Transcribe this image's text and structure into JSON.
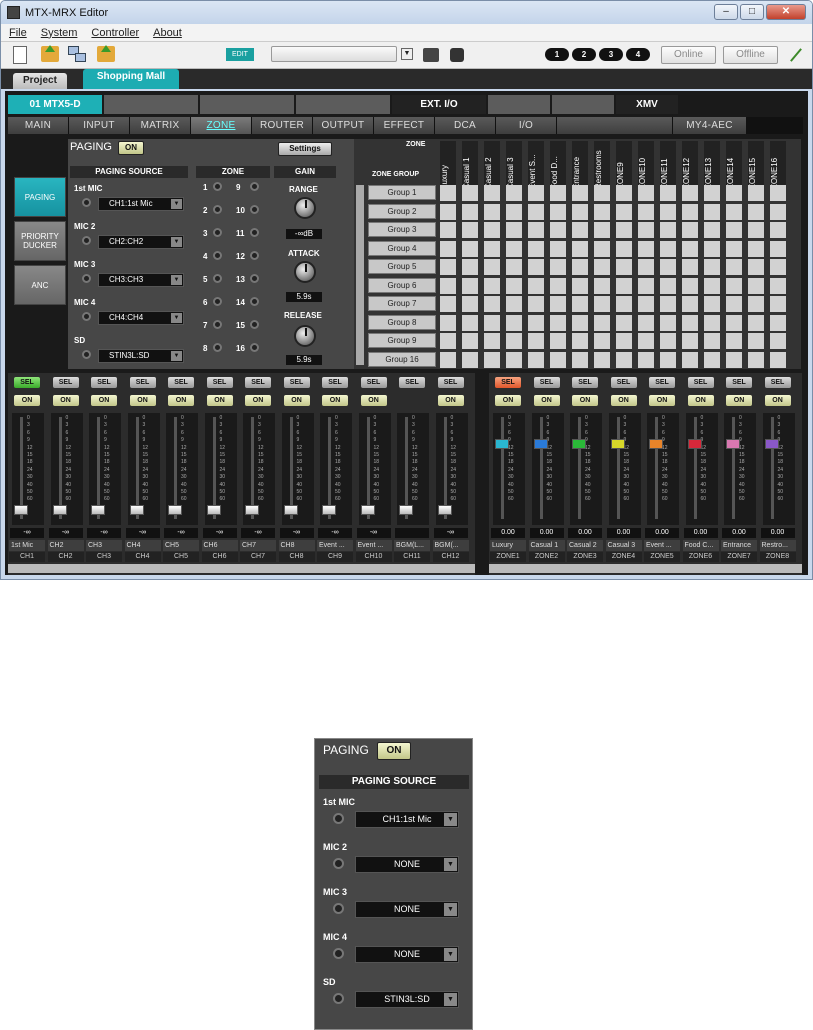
{
  "window": {
    "title": "MTX-MRX Editor"
  },
  "menu": [
    "File",
    "System",
    "Controller",
    "About"
  ],
  "toolbar": {
    "edit_badge": "EDIT",
    "devices": [
      "1",
      "2",
      "3",
      "4"
    ],
    "online": "Online",
    "offline": "Offline"
  },
  "project_tabs": {
    "project": "Project",
    "current": "Shopping Mall"
  },
  "device_tabs": [
    "01 MTX5-D",
    "",
    "",
    "",
    "EXT. I/O",
    "",
    "",
    "XMV"
  ],
  "function_tabs": [
    "MAIN",
    "INPUT",
    "MATRIX",
    "ZONE",
    "ROUTER",
    "OUTPUT",
    "EFFECT",
    "DCA",
    "I/O",
    "",
    "MY4-AEC"
  ],
  "left_nav": [
    "PAGING",
    "PRIORITY DUCKER",
    "ANC"
  ],
  "paging": {
    "title": "PAGING",
    "on": "ON",
    "settings": "Settings",
    "source_title": "PAGING SOURCE",
    "zone_title": "ZONE",
    "gain_title": "GAIN",
    "sources": [
      {
        "label": "1st MIC",
        "value": "CH1:1st Mic"
      },
      {
        "label": "MIC 2",
        "value": "CH2:CH2"
      },
      {
        "label": "MIC 3",
        "value": "CH3:CH3"
      },
      {
        "label": "MIC 4",
        "value": "CH4:CH4"
      },
      {
        "label": "SD",
        "value": "STIN3L:SD"
      }
    ],
    "zones_left": [
      "1",
      "2",
      "3",
      "4",
      "5",
      "6",
      "7",
      "8"
    ],
    "zones_right": [
      "9",
      "10",
      "11",
      "12",
      "13",
      "14",
      "15",
      "16"
    ],
    "range_label": "RANGE",
    "range_value": "-∞dB",
    "attack_label": "ATTACK",
    "attack_value": "5.9s",
    "release_label": "RELEASE",
    "release_value": "5.9s"
  },
  "zone_matrix": {
    "zone_label": "ZONE",
    "group_label": "ZONE GROUP",
    "zones": [
      "Luxury",
      "Casual 1",
      "Casual 2",
      "Casual 3",
      "Event S...",
      "Food D...",
      "Entrance",
      "Restrooms",
      "ZONE9",
      "ZONE10",
      "ZONE11",
      "ZONE12",
      "ZONE13",
      "ZONE14",
      "ZONE15",
      "ZONE16"
    ],
    "groups": [
      "Group 1",
      "Group 2",
      "Group 3",
      "Group 4",
      "Group 5",
      "Group 6",
      "Group 7",
      "Group 8",
      "Group 9",
      "Group 16"
    ]
  },
  "input_channels": [
    {
      "sel": "SEL",
      "on": "ON",
      "val": "-∞",
      "name": "1st Mic",
      "id": "CH1"
    },
    {
      "sel": "SEL",
      "on": "ON",
      "val": "-∞",
      "name": "CH2",
      "id": "CH2"
    },
    {
      "sel": "SEL",
      "on": "ON",
      "val": "-∞",
      "name": "CH3",
      "id": "CH3"
    },
    {
      "sel": "SEL",
      "on": "ON",
      "val": "-∞",
      "name": "CH4",
      "id": "CH4"
    },
    {
      "sel": "SEL",
      "on": "ON",
      "val": "-∞",
      "name": "CH5",
      "id": "CH5"
    },
    {
      "sel": "SEL",
      "on": "ON",
      "val": "-∞",
      "name": "CH6",
      "id": "CH6"
    },
    {
      "sel": "SEL",
      "on": "ON",
      "val": "-∞",
      "name": "CH7",
      "id": "CH7"
    },
    {
      "sel": "SEL",
      "on": "ON",
      "val": "-∞",
      "name": "CH8",
      "id": "CH8"
    },
    {
      "sel": "SEL",
      "on": "ON",
      "val": "-∞",
      "name": "Event ...",
      "id": "CH9"
    },
    {
      "sel": "SEL",
      "on": "ON",
      "val": "-∞",
      "name": "Event ...",
      "id": "CH10"
    },
    {
      "sel": "SEL",
      "on": "",
      "val": "",
      "name": "BGM(L...",
      "id": "CH11"
    },
    {
      "sel": "SEL",
      "on": "ON",
      "val": "-∞",
      "name": "BGM(...",
      "id": "CH12"
    }
  ],
  "zone_channels": [
    {
      "sel": "SEL",
      "on": "ON",
      "val": "0.00",
      "name": "Luxury",
      "id": "ZONE1",
      "color": "#2ab6d0"
    },
    {
      "sel": "SEL",
      "on": "ON",
      "val": "0.00",
      "name": "Casual 1",
      "id": "ZONE2",
      "color": "#2a7ad8"
    },
    {
      "sel": "SEL",
      "on": "ON",
      "val": "0.00",
      "name": "Casual 2",
      "id": "ZONE3",
      "color": "#2ab838"
    },
    {
      "sel": "SEL",
      "on": "ON",
      "val": "0.00",
      "name": "Casual 3",
      "id": "ZONE4",
      "color": "#d8d82a"
    },
    {
      "sel": "SEL",
      "on": "ON",
      "val": "0.00",
      "name": "Event ...",
      "id": "ZONE5",
      "color": "#e8842a"
    },
    {
      "sel": "SEL",
      "on": "ON",
      "val": "0.00",
      "name": "Food C...",
      "id": "ZONE6",
      "color": "#d8283a"
    },
    {
      "sel": "SEL",
      "on": "ON",
      "val": "0.00",
      "name": "Entrance",
      "id": "ZONE7",
      "color": "#d878b0"
    },
    {
      "sel": "SEL",
      "on": "ON",
      "val": "0.00",
      "name": "Restro...",
      "id": "ZONE8",
      "color": "#8a58c8"
    }
  ],
  "fader_scale": [
    "0",
    "3",
    "6",
    "9",
    "12",
    "15",
    "18",
    "24",
    "30",
    "40",
    "50",
    "60"
  ],
  "inset": {
    "title": "PAGING",
    "on": "ON",
    "source_title": "PAGING SOURCE",
    "sources": [
      {
        "label": "1st MIC",
        "value": "CH1:1st Mic"
      },
      {
        "label": "MIC 2",
        "value": "NONE"
      },
      {
        "label": "MIC 3",
        "value": "NONE"
      },
      {
        "label": "MIC 4",
        "value": "NONE"
      },
      {
        "label": "SD",
        "value": "STIN3L:SD"
      }
    ]
  }
}
